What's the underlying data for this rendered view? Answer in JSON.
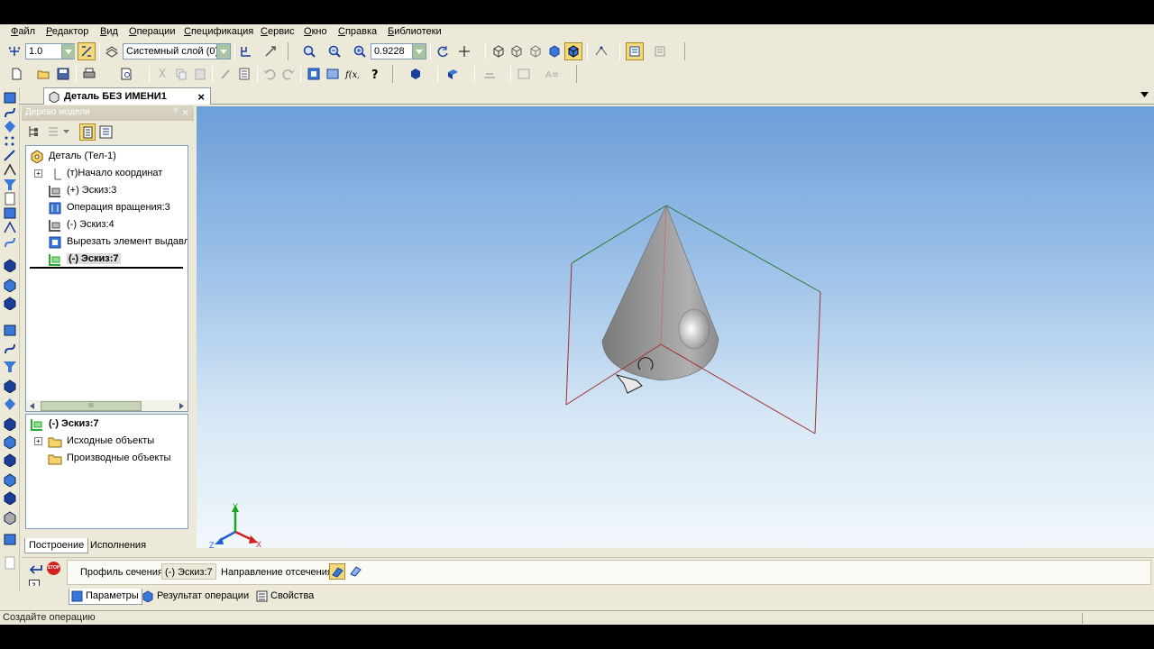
{
  "menu": [
    "Файл",
    "Редактор",
    "Вид",
    "Операции",
    "Спецификация",
    "Сервис",
    "Окно",
    "Справка",
    "Библиотеки"
  ],
  "toolbar": {
    "step_value": "1.0",
    "layer_value": "Системный слой (0)",
    "zoom_value": "0.9228"
  },
  "document_tab": {
    "title": "Деталь БЕЗ ИМЕНИ1",
    "close": "×"
  },
  "tree_panel": {
    "header": "Дерево модели",
    "pin": "ᵖ",
    "close": "×",
    "items": [
      {
        "label": "Деталь (Тел-1)",
        "icon": "part-icon"
      },
      {
        "label": "(т)Начало координат",
        "icon": "origin-icon"
      },
      {
        "label": "(+) Эскиз:3",
        "icon": "sketch-icon"
      },
      {
        "label": "Операция вращения:3",
        "icon": "revolve-icon"
      },
      {
        "label": "(-) Эскиз:4",
        "icon": "sketch-icon"
      },
      {
        "label": "Вырезать элемент выдавли",
        "icon": "cut-extrude-icon"
      },
      {
        "label": "(-) Эскиз:7",
        "icon": "sketch-icon"
      }
    ],
    "scroll_grip": "III",
    "bottom_title": "(-) Эскиз:7",
    "bottom_items": [
      "Исходные объекты",
      "Производные объекты"
    ],
    "tabs": [
      "Построение",
      "Исполнения"
    ]
  },
  "axes": {
    "x": "X",
    "y": "Y",
    "z": "Z"
  },
  "property_bar": {
    "profile_label": "Профиль сечения",
    "profile_value": "(-) Эскиз:7",
    "direction_label": "Направление отсечения",
    "stop_label": "STOP"
  },
  "prop_tabs": [
    "Параметры",
    "Результат операции",
    "Свойства"
  ],
  "status": "Создайте операцию",
  "colors": {
    "active_button": "#f3d97a",
    "sketch_green": "#2aa832",
    "viewport_top": "#6c9ed8",
    "viewport_bottom": "#f2f7fb"
  }
}
